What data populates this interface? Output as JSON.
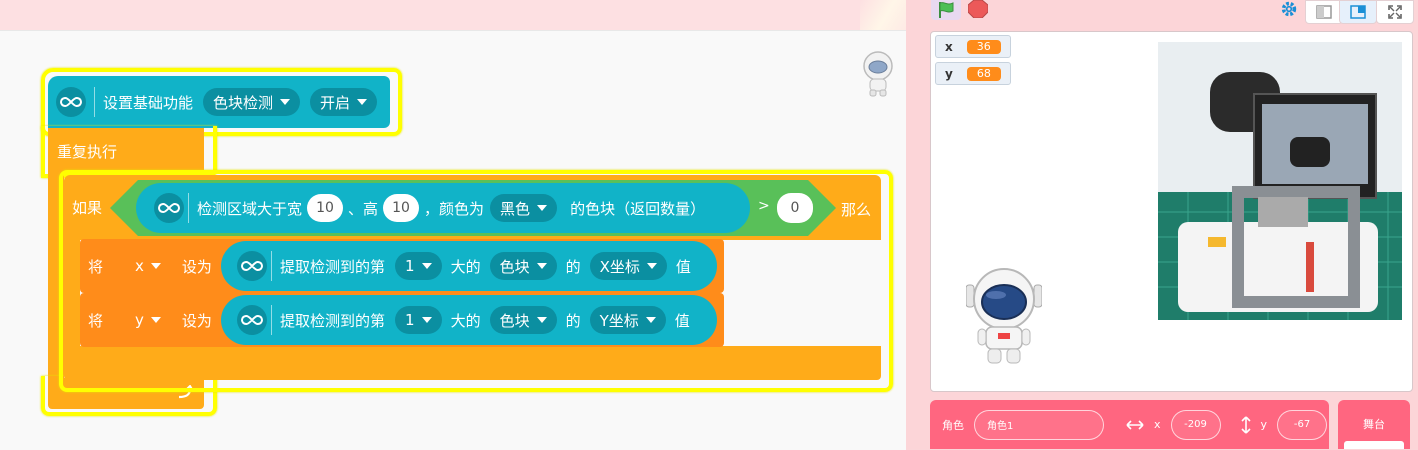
{
  "hat_block": {
    "label": "设置基础功能",
    "function_value": "色块检测",
    "state_value": "开启"
  },
  "repeat_block": {
    "label": "重复执行"
  },
  "if_block": {
    "if_label": "如果",
    "then_label": "那么",
    "condition": {
      "label_1": "检测区域大于宽",
      "width_value": "10",
      "label_2": "、高",
      "height_value": "10",
      "label_3": "，颜色为",
      "color_value": "黑色",
      "label_4": "的色块（返回数量）",
      "operator": ">",
      "compare_value": "0"
    }
  },
  "set_x_block": {
    "set_label": "将",
    "variable": "x",
    "to_label": "设为",
    "reporter_label": "提取检测到的第",
    "rank_value": "1",
    "big_label": "大的",
    "type_value": "色块",
    "of_label": "的",
    "coord_value": "X坐标",
    "value_label": "值"
  },
  "set_y_block": {
    "set_label": "将",
    "variable": "y",
    "to_label": "设为",
    "reporter_label": "提取检测到的第",
    "rank_value": "1",
    "big_label": "大的",
    "type_value": "色块",
    "of_label": "的",
    "coord_value": "Y坐标",
    "value_label": "值"
  },
  "monitors": [
    {
      "name": "x",
      "value": "36"
    },
    {
      "name": "y",
      "value": "68"
    }
  ],
  "sprite_panel": {
    "sprite_label": "角色",
    "sprite_name": "角色1",
    "x_label": "x",
    "x_value": "-209",
    "y_label": "y",
    "y_value": "-67"
  },
  "stage_panel": {
    "label": "舞台"
  },
  "colors": {
    "extension_cyan": "#11b3c8",
    "control_orange": "#ffab19",
    "variable_orange": "#ff8c1a",
    "operator_green": "#59c059",
    "highlight_yellow": "#ffff00",
    "sprite_panel_pink": "#ff6680",
    "green_flag": "#4cbf56",
    "stop_red": "#ec5959"
  },
  "icons": [
    "infinity-icon",
    "green-flag-icon",
    "stop-icon",
    "gear-icon",
    "small-stage-icon",
    "normal-stage-icon",
    "fullscreen-icon",
    "astronaut-icon",
    "return-arrow-icon"
  ]
}
